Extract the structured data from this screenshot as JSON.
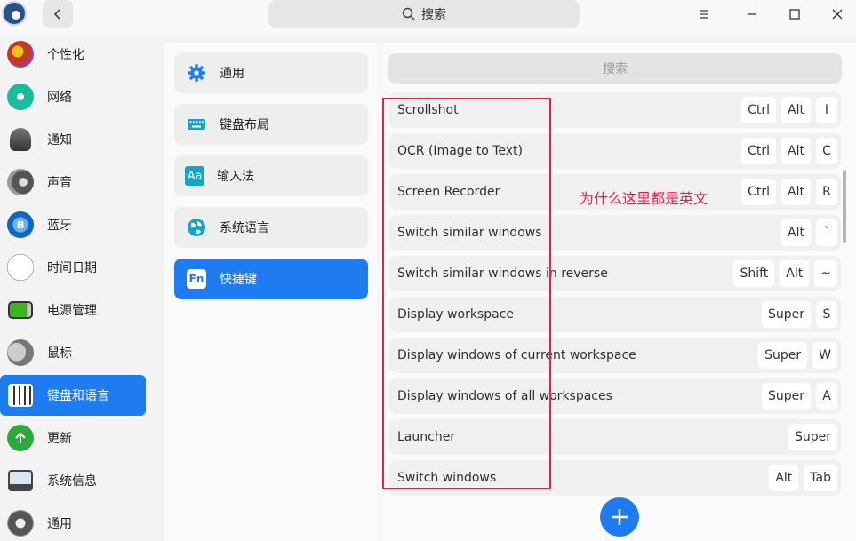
{
  "titlebar": {
    "search_text": "搜索"
  },
  "sidebar": {
    "items": [
      {
        "label": "个性化",
        "icon": "personalization-icon",
        "color": "#c0392b"
      },
      {
        "label": "网络",
        "icon": "network-icon",
        "color": "#1abc9c"
      },
      {
        "label": "通知",
        "icon": "notification-bell-icon",
        "color": "#555555"
      },
      {
        "label": "声音",
        "icon": "speaker-icon",
        "color": "#666666"
      },
      {
        "label": "蓝牙",
        "icon": "bluetooth-icon",
        "color": "#1e88e5"
      },
      {
        "label": "时间日期",
        "icon": "clock-icon",
        "color": "#444444"
      },
      {
        "label": "电源管理",
        "icon": "battery-icon",
        "color": "#3cb521"
      },
      {
        "label": "鼠标",
        "icon": "mouse-icon",
        "color": "#777777"
      },
      {
        "label": "键盘和语言",
        "icon": "keyboard-icon",
        "color": "#333333"
      },
      {
        "label": "更新",
        "icon": "update-arrow-icon",
        "color": "#2eaa3c"
      },
      {
        "label": "系统信息",
        "icon": "system-info-icon",
        "color": "#2d6fbf"
      },
      {
        "label": "通用",
        "icon": "general-gear-icon",
        "color": "#555555"
      }
    ],
    "active_index": 8
  },
  "midnav": {
    "items": [
      {
        "label": "通用",
        "icon": "gear-icon"
      },
      {
        "label": "键盘布局",
        "icon": "keyboard-layout-icon"
      },
      {
        "label": "输入法",
        "icon": "input-method-icon",
        "icon_text": "Aa"
      },
      {
        "label": "系统语言",
        "icon": "globe-icon"
      },
      {
        "label": "快捷键",
        "icon": "shortcut-fn-icon",
        "icon_text": "Fn"
      }
    ],
    "active_index": 4
  },
  "shortcuts": {
    "search_placeholder": "搜索",
    "rows": [
      {
        "label": "Scrollshot",
        "keys": [
          "Ctrl",
          "Alt",
          "I"
        ]
      },
      {
        "label": "OCR (Image to Text)",
        "keys": [
          "Ctrl",
          "Alt",
          "C"
        ]
      },
      {
        "label": "Screen Recorder",
        "keys": [
          "Ctrl",
          "Alt",
          "R"
        ]
      },
      {
        "label": "Switch similar windows",
        "keys": [
          "Alt",
          "`"
        ]
      },
      {
        "label": "Switch similar windows in reverse",
        "keys": [
          "Shift",
          "Alt",
          "~"
        ]
      },
      {
        "label": "Display workspace",
        "keys": [
          "Super",
          "S"
        ]
      },
      {
        "label": "Display windows of current workspace",
        "keys": [
          "Super",
          "W"
        ]
      },
      {
        "label": "Display windows of all workspaces",
        "keys": [
          "Super",
          "A"
        ]
      },
      {
        "label": "Launcher",
        "keys": [
          "Super"
        ]
      },
      {
        "label": "Switch windows",
        "keys": [
          "Alt",
          "Tab"
        ]
      }
    ]
  },
  "annotation": {
    "text": "为什么这里都是英文",
    "color": "#e8204b"
  },
  "colors": {
    "accent": "#1e7bf0"
  }
}
